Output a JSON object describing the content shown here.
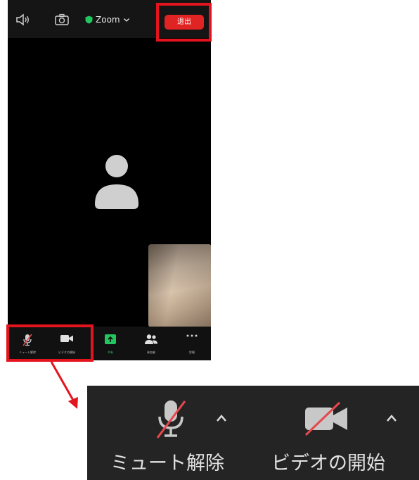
{
  "topbar": {
    "meeting_name": "Zoom",
    "leave_label": "退出",
    "icons": [
      "speaker-icon",
      "camera-switch-icon",
      "shield-icon",
      "chevron-down-icon"
    ]
  },
  "toolbar": {
    "items": [
      {
        "label": "ミュート解除",
        "icon": "muted-mic-icon"
      },
      {
        "label": "ビデオの開始",
        "icon": "video-camera-icon"
      },
      {
        "label": "共有",
        "icon": "share-screen-icon"
      },
      {
        "label": "参加者",
        "icon": "participants-icon"
      },
      {
        "label": "詳細",
        "icon": "more-icon"
      }
    ]
  },
  "zoomed_panel": {
    "mute_label": "ミュート解除",
    "video_label": "ビデオの開始"
  },
  "colors": {
    "highlight": "#e4141e",
    "leave_button": "#e02424",
    "panel_bg": "#242424",
    "share_green": "#22c55e",
    "slash_red": "#e5484d"
  }
}
